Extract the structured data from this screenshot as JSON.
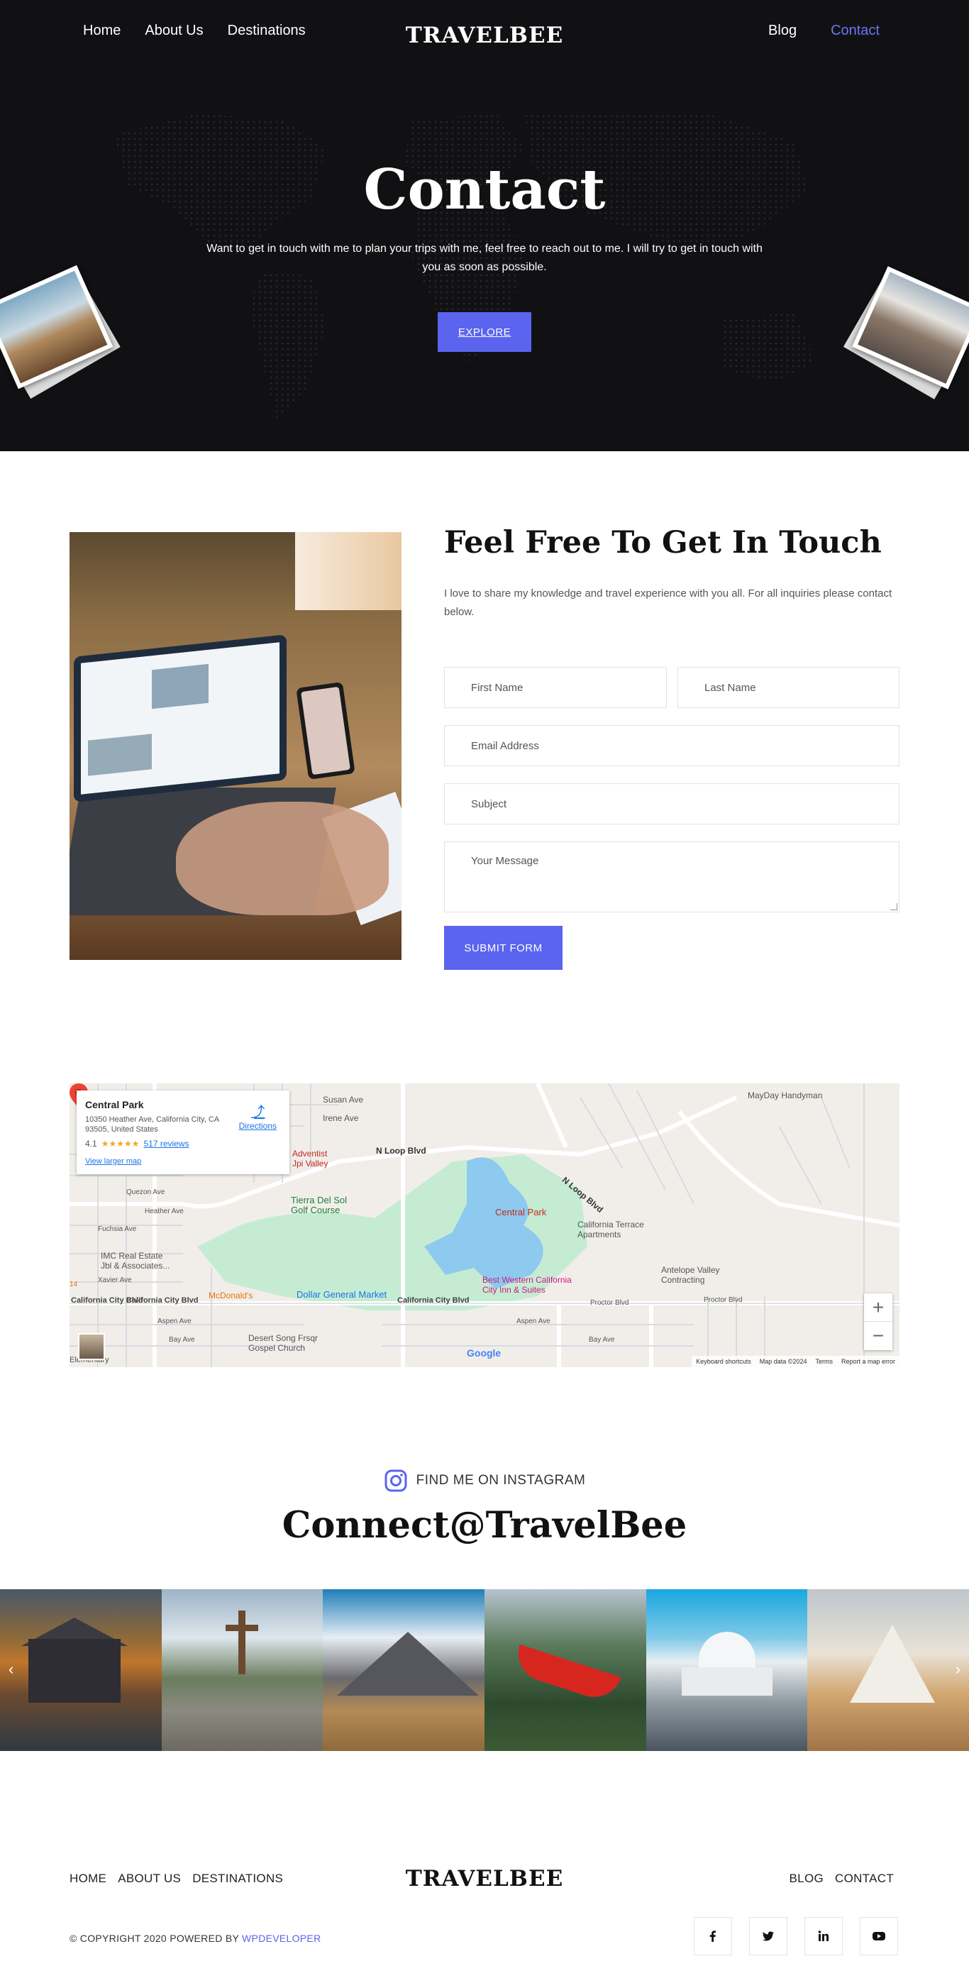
{
  "header": {
    "nav_left": [
      "Home",
      "About Us",
      "Destinations"
    ],
    "logo": "TRAVELBEE",
    "nav_right": [
      "Blog",
      "Contact"
    ]
  },
  "hero": {
    "title": "Contact",
    "subtitle": "Want to get in touch with me to plan your trips with me, feel free to reach out to me. I will try to get in touch with you as soon as possible.",
    "button": "EXPLORE"
  },
  "contact": {
    "heading": "Feel Free To Get In Touch",
    "intro": "I love to share my knowledge and travel experience with you all. For all inquiries please contact below.",
    "fields": {
      "first_name": "First Name",
      "last_name": "Last Name",
      "email": "Email Address",
      "subject": "Subject",
      "message": "Your Message"
    },
    "submit": "SUBMIT FORM"
  },
  "map": {
    "place_title": "Central Park",
    "place_address": "10350 Heather Ave, California City, CA 93505, United States",
    "rating": "4.1",
    "stars": "★★★★★",
    "reviews": "517 reviews",
    "larger_map": "View larger map",
    "directions": "Directions",
    "pin_label": "Central Park",
    "labels": {
      "susan": "Susan Ave",
      "irene": "Irene Ave",
      "nloop": "N Loop Blvd",
      "nloop2": "N Loop Blvd",
      "tierra": "Tierra Del Sol\nGolf Course",
      "adventist": "Adventist\nJpi Valley",
      "quezon": "Quezon Ave",
      "heather": "Heather Ave",
      "fuchsia": "Fuchsia Ave",
      "imc": "IMC Real Estate\nJbl & Associates...",
      "xavier": "Xavier Ave",
      "mcdonalds": "McDonald's",
      "dollar": "Dollar General Market",
      "calcity1": "California City Blvd",
      "calcity2": "California City Blvd",
      "calcity3": "California City Blvd",
      "aspen": "Aspen Ave",
      "aspen2": "Aspen Ave",
      "bay": "Bay Ave",
      "bay2": "Bay Ave",
      "desert": "Desert Song Frsqr\nGospel Church",
      "terrace": "California Terrace\nApartments",
      "antelope": "Antelope Valley\nContracting",
      "bestwestern": "Best Western California\nCity Inn & Suites",
      "mayday": "MayDay Handyman",
      "proctor": "Proctor Blvd",
      "proctor2": "Proctor Blvd",
      "blvd14": "14",
      "elementary": "Elementary"
    },
    "footer": [
      "Keyboard shortcuts",
      "Map data ©2024",
      "Terms",
      "Report a map error"
    ],
    "google": "Google",
    "zoom_in": "+",
    "zoom_out": "−"
  },
  "instagram": {
    "label": "FIND ME ON INSTAGRAM",
    "handle": "Connect@TravelBee",
    "prev": "‹",
    "next": "›"
  },
  "footer": {
    "nav_left": [
      "HOME",
      "ABOUT US",
      "DESTINATIONS"
    ],
    "logo": "TRAVELBEE",
    "nav_right": [
      "BLOG",
      "CONTACT"
    ],
    "copyright_prefix": "© COPYRIGHT 2020 POWERED BY ",
    "copyright_link": "WPDEVELOPER",
    "socials": [
      "f",
      "t",
      "in",
      "▶"
    ]
  },
  "colors": {
    "accent": "#5a64ef",
    "hero_bg": "#111114",
    "active_nav": "#6b75f5"
  },
  "icons": [
    "instagram-icon",
    "directions-icon",
    "map-pin-icon",
    "facebook-icon",
    "twitter-icon",
    "linkedin-icon",
    "youtube-icon",
    "chevron-left-icon",
    "chevron-right-icon"
  ]
}
